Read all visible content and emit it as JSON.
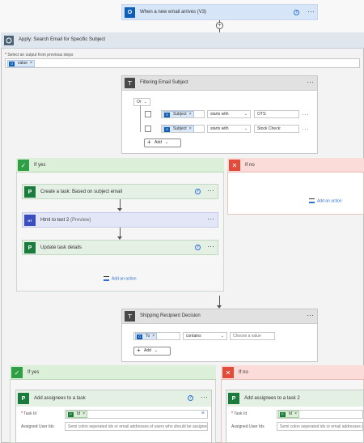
{
  "trigger": {
    "title": "When a new email arrives (V3)"
  },
  "apply": {
    "title": "Apply: Search Email for Specific Subject",
    "select_label": "Select an output from previous steps",
    "token": "value"
  },
  "filter": {
    "title": "Filtering Email Subject",
    "group_op": "Or",
    "rows": [
      {
        "token": "Subject",
        "operator": "starts with",
        "value": "OTS:"
      },
      {
        "token": "Subject",
        "operator": "starts with",
        "value": "Stock Check:"
      }
    ],
    "add_label": "Add"
  },
  "if_yes_1": {
    "header": "If yes",
    "actions": [
      {
        "title": "Create a task: Based on subject email"
      },
      {
        "title": "Html to text 2",
        "tag": "(Preview)"
      },
      {
        "title": "Update task details"
      }
    ],
    "add_action": "Add an action"
  },
  "if_no_1": {
    "header": "If no",
    "add_action": "Add an action"
  },
  "shipping": {
    "title": "Shipping Recipient Decision",
    "token": "To",
    "operator": "contains",
    "value_placeholder": "Choose a value",
    "add_label": "Add"
  },
  "if_yes_2": {
    "header": "If yes",
    "card_title": "Add assignees to a task",
    "task_label": "Task Id",
    "task_token": "Id",
    "users_label": "Assigned User Ids",
    "users_placeholder": "Semi colon seperated ids or email addresses of users who should be assigned t"
  },
  "if_no_2": {
    "header": "If no",
    "card_title": "Add assignees to a task 2",
    "task_label": "Task Id",
    "task_token": "Id",
    "users_label": "Assigned User Ids",
    "users_placeholder": "Semi colon seperated ids or email addresses of u"
  },
  "icons": {
    "help": "?",
    "more": "···",
    "yes": "✓",
    "no": "✕",
    "close": "×",
    "chevron": "⌄",
    "plus": "+"
  },
  "colors": {
    "trigger_bg": "#d6e6f8",
    "yes_header": "#dcefd9",
    "no_header": "#fcdcd9",
    "accent": "#2f6fd6"
  }
}
